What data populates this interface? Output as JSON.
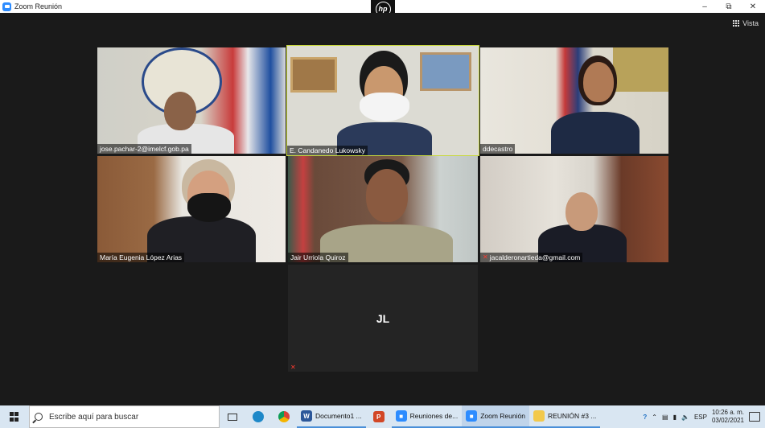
{
  "window": {
    "title": "Zoom Reunión"
  },
  "view_button": {
    "label": "Vista"
  },
  "participants": [
    {
      "name": "jose.pachar-2@imelcf.gob.pa",
      "muted": false,
      "active": false
    },
    {
      "name": "E. Candanedo Lukowsky",
      "muted": false,
      "active": true
    },
    {
      "name": "ddecastro",
      "muted": false,
      "active": false
    },
    {
      "name": "María Eugenia López Arias",
      "muted": false,
      "active": false
    },
    {
      "name": "Jair Urriola Quiroz",
      "muted": false,
      "active": false
    },
    {
      "name": "jacalderonartieda@gmail.com",
      "muted": true,
      "active": false
    },
    {
      "initials": "JL",
      "muted": true,
      "active": false
    }
  ],
  "taskbar": {
    "search_placeholder": "Escribe aquí para buscar",
    "apps": [
      {
        "label": "Documento1 ...",
        "icon": "word-icon",
        "color": "#2b579a"
      },
      {
        "label": "Reuniones de...",
        "icon": "zoom-icon",
        "color": "#2d8cff"
      },
      {
        "label": "Zoom Reunión",
        "icon": "zoom-icon",
        "color": "#2d8cff"
      },
      {
        "label": "REUNIÓN #3 ...",
        "icon": "folder-icon",
        "color": "#f2c94c"
      }
    ],
    "language": "ESP",
    "time": "10:26 a. m.",
    "date": "03/02/2021"
  }
}
